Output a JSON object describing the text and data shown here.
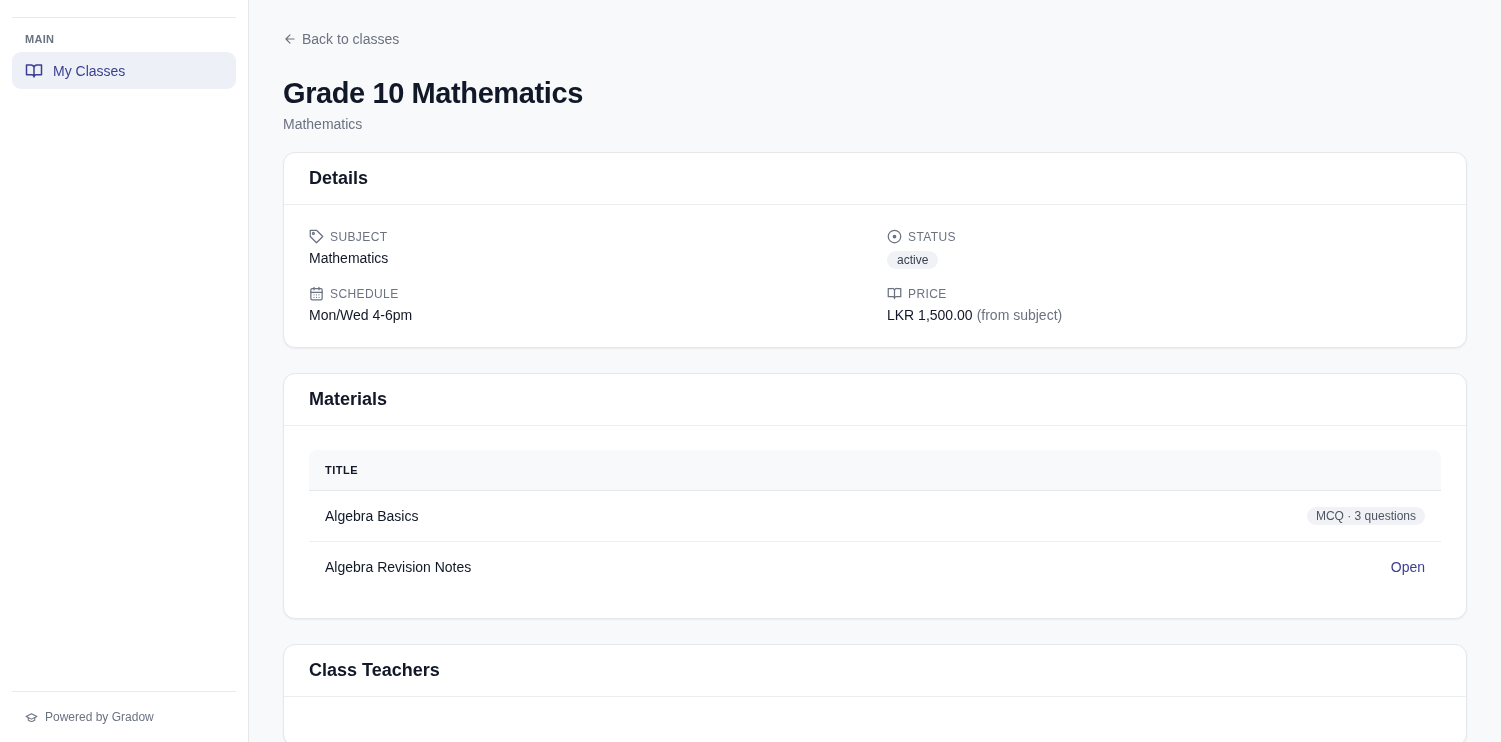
{
  "sidebar": {
    "section_label": "MAIN",
    "items": [
      {
        "label": "My Classes",
        "selected": true
      }
    ],
    "footer": "Powered by Gradow"
  },
  "back_link": "Back to classes",
  "page": {
    "title": "Grade 10 Mathematics",
    "subtitle": "Mathematics"
  },
  "details": {
    "title": "Details",
    "fields": [
      {
        "label": "SUBJECT",
        "kind": "text",
        "value": "Mathematics"
      },
      {
        "label": "STATUS",
        "kind": "badge",
        "value": "active"
      },
      {
        "label": "SCHEDULE",
        "kind": "text",
        "value": "Mon/Wed 4-6pm"
      },
      {
        "label": "PRICE",
        "kind": "text",
        "value": "LKR 1,500.00",
        "note": "(from subject)"
      }
    ]
  },
  "materials": {
    "title": "Materials",
    "columns": [
      "TITLE"
    ],
    "rows": [
      {
        "title": "Algebra Basics",
        "kind": "badge",
        "action": "MCQ · 3 questions"
      },
      {
        "title": "Algebra Revision Notes",
        "kind": "link",
        "action": "Open"
      }
    ]
  },
  "teachers": {
    "title": "Class Teachers"
  }
}
